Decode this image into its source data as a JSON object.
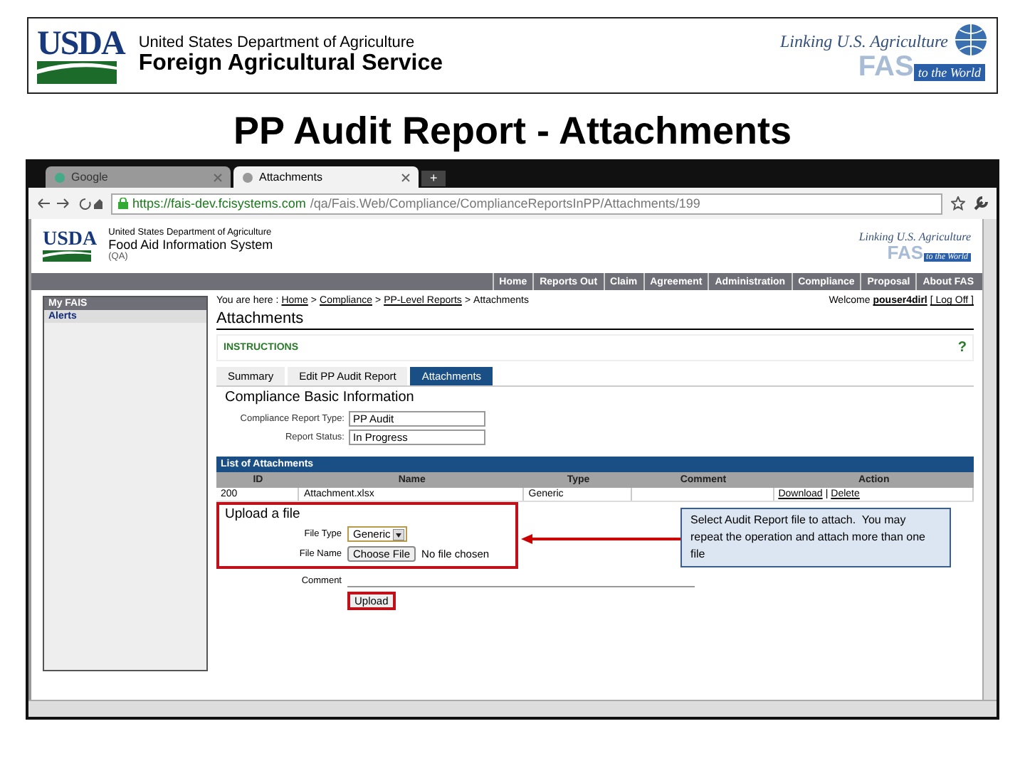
{
  "slide": {
    "title": "PP Audit Report - Attachments"
  },
  "header": {
    "logo": "USDA",
    "department": "United States Department of Agriculture",
    "service": "Foreign Agricultural Service",
    "tagline": "Linking U.S. Agriculture",
    "fas": "FAS",
    "world": "to the World"
  },
  "browser": {
    "tabs": [
      {
        "label": "Google",
        "selected": false
      },
      {
        "label": "Attachments",
        "selected": true
      }
    ],
    "new_tab": "+",
    "url_host": "https://fais-dev.fcisystems.com",
    "url_path": "/qa/Fais.Web/Compliance/ComplianceReportsInPP/Attachments/199"
  },
  "site": {
    "logo": "USDA",
    "department": "United States Department of Agriculture",
    "system": "Food Aid Information System",
    "env": "(QA)",
    "tagline": "Linking U.S. Agriculture",
    "fas": "FAS",
    "world": "to the World"
  },
  "nav": [
    "Home",
    "Reports Out",
    "Claim",
    "Agreement",
    "Administration",
    "Compliance",
    "Proposal",
    "About FAS"
  ],
  "sidebar": {
    "heading": "My FAIS",
    "items": [
      {
        "label": "Alerts"
      }
    ]
  },
  "breadcrumb": {
    "prefix": "You are here :",
    "links": [
      "Home",
      "Compliance",
      "PP-Level Reports"
    ],
    "separator": ">",
    "current": "Attachments"
  },
  "welcome": {
    "label": "Welcome",
    "user": "pouser4dirl",
    "logoff": "[ Log Off ]"
  },
  "page_title": "Attachments",
  "instructions": {
    "label": "INSTRUCTIONS",
    "help": "?"
  },
  "tabs": [
    {
      "label": "Summary",
      "selected": false
    },
    {
      "label": "Edit PP Audit Report",
      "selected": false
    },
    {
      "label": "Attachments",
      "selected": true
    }
  ],
  "section_title": "Compliance Basic Information",
  "fields": [
    {
      "label": "Compliance Report Type:",
      "value": "PP Audit"
    },
    {
      "label": "Report Status:",
      "value": "In Progress"
    }
  ],
  "attachments": {
    "title": "List of Attachments",
    "columns": [
      "ID",
      "Name",
      "Type",
      "Comment",
      "Action"
    ],
    "rows": [
      {
        "id": "200",
        "name": "Attachment.xlsx",
        "type": "Generic",
        "actions": [
          "Download",
          "Delete"
        ],
        "separator": "|"
      }
    ]
  },
  "upload": {
    "title": "Upload a file",
    "file_type_label": "File Type",
    "file_type_value": "Generic",
    "file_name_label": "File Name",
    "choose_button": "Choose File",
    "file_status": "No file chosen",
    "comment_label": "Comment",
    "button": "Upload"
  },
  "callout": {
    "text": "Select Audit Report file to attach.  You may repeat the operation and attach more than one file"
  }
}
